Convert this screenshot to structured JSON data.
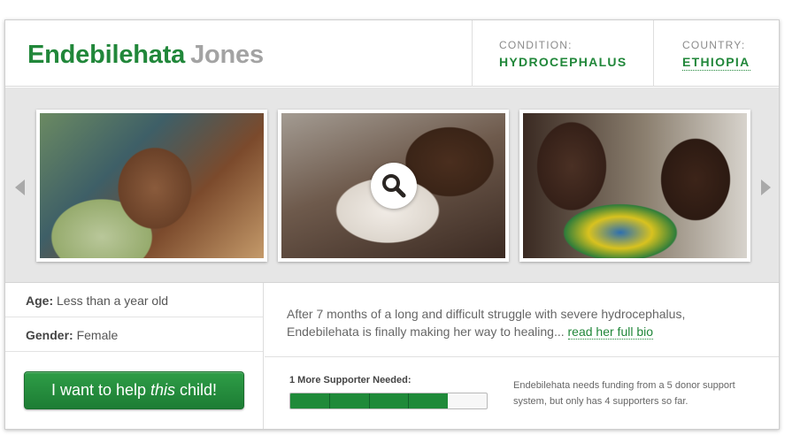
{
  "child": {
    "first_name": "Endebilehata",
    "last_name": "Jones"
  },
  "condition": {
    "label": "CONDITION:",
    "value": "HYDROCEPHALUS"
  },
  "country": {
    "label": "COUNTRY:",
    "value": "ETHIOPIA"
  },
  "gallery": {
    "photos": [
      "baby-face-photo",
      "baby-in-hospital-photo",
      "mother-holding-baby-photo"
    ],
    "icons": {
      "prev": "chevron-left-icon",
      "next": "chevron-right-icon",
      "zoom": "magnifier-icon"
    }
  },
  "details": {
    "age_label": "Age:",
    "age_value": "Less than a year old",
    "gender_label": "Gender:",
    "gender_value": "Female"
  },
  "cta": {
    "before": "I want to help ",
    "emphasis": "this",
    "after": " child!"
  },
  "bio": {
    "text": "After 7 months of a long and difficult struggle with severe hydrocephalus, Endebilehata is finally making her way to healing... ",
    "link": "read her full bio"
  },
  "progress": {
    "label": "1 More Supporter Needed:",
    "supporters": 4,
    "total": 5,
    "note": "Endebilehata needs funding from a 5 donor support system, but only has 4 supporters so far."
  },
  "colors": {
    "accent": "#21873a",
    "muted_name": "#a3a3a3"
  }
}
